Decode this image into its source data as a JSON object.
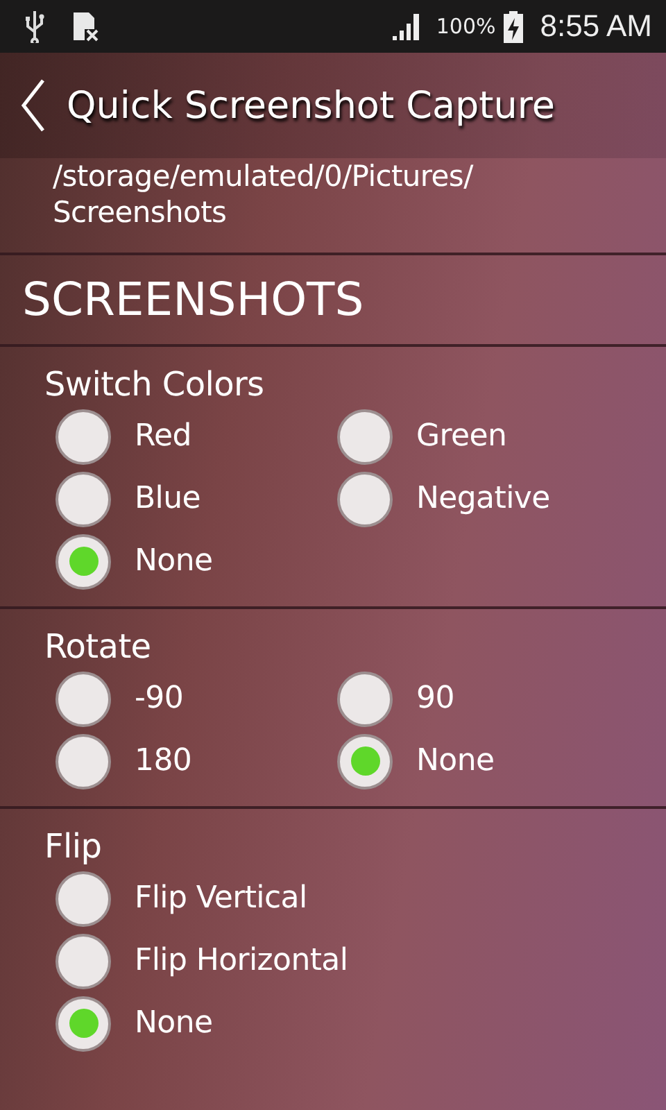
{
  "status_bar": {
    "battery_percent": "100%",
    "time": "8:55 AM"
  },
  "header": {
    "title": "Quick Screenshot Capture"
  },
  "path": "/storage/emulated/0/Pictures/\nScreenshots",
  "section_title": "SCREENSHOTS",
  "groups": [
    {
      "title": "Switch Colors",
      "kind": "two-column",
      "options": [
        {
          "label": "Red",
          "selected": false
        },
        {
          "label": "Green",
          "selected": false
        },
        {
          "label": "Blue",
          "selected": false
        },
        {
          "label": "Negative",
          "selected": false
        },
        {
          "label": "None",
          "selected": true
        }
      ]
    },
    {
      "title": "Rotate",
      "kind": "two-column",
      "options": [
        {
          "label": "-90",
          "selected": false
        },
        {
          "label": "90",
          "selected": false
        },
        {
          "label": "180",
          "selected": false
        },
        {
          "label": "None",
          "selected": true
        }
      ]
    },
    {
      "title": "Flip",
      "kind": "one-column",
      "options": [
        {
          "label": "Flip Vertical",
          "selected": false
        },
        {
          "label": "Flip Horizontal",
          "selected": false
        },
        {
          "label": "None",
          "selected": true
        }
      ]
    }
  ]
}
